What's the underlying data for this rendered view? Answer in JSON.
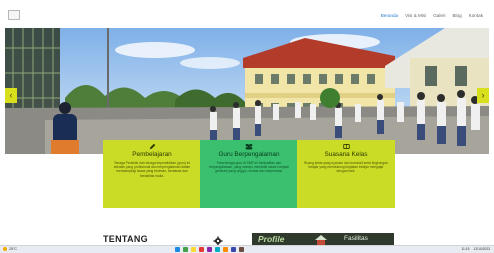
{
  "nav": {
    "items": [
      "Beranda",
      "Visi & Misi",
      "Galeri",
      "Blog",
      "Kontak"
    ],
    "active_index": 0
  },
  "hero": {
    "prev_symbol": "‹",
    "next_symbol": "›"
  },
  "cards": [
    {
      "icon": "pencil-icon",
      "title": "Pembelajaran",
      "text": "Tenaga Pendidik dan tenaga kependidikan (guru) ini sekolah yang profesional dan berpengalaman dalam mendampingi siswa yang beriman, bertakwa dan berakhlak mulia."
    },
    {
      "icon": "group-icon",
      "title": "Guru Berpengalaman",
      "text": "Para tenaga guru di SMP ini berkualitas dan berpengalaman, yang mampu mendidik siswa menjadi generasi yang unggul, cerdas dan berprestasi."
    },
    {
      "icon": "book-icon",
      "title": "Suasana Kelas",
      "text": "Ruang kelas yang nyaman dan kondusif serta lingkungan belajar yang mendukung kegiatan belajar mengajar dengan baik."
    }
  ],
  "section": {
    "heading": "TENTANG"
  },
  "promo": {
    "word1": "Profile",
    "word2": "Fasilitas"
  },
  "taskbar": {
    "weather": "25°C",
    "time": "11:15",
    "date": "12/10/2023",
    "icon_colors": [
      "#1e88e5",
      "#43a047",
      "#fdd835",
      "#e53935",
      "#8e24aa",
      "#00acc1",
      "#fb8c00",
      "#3949ab",
      "#6d4c41"
    ]
  }
}
